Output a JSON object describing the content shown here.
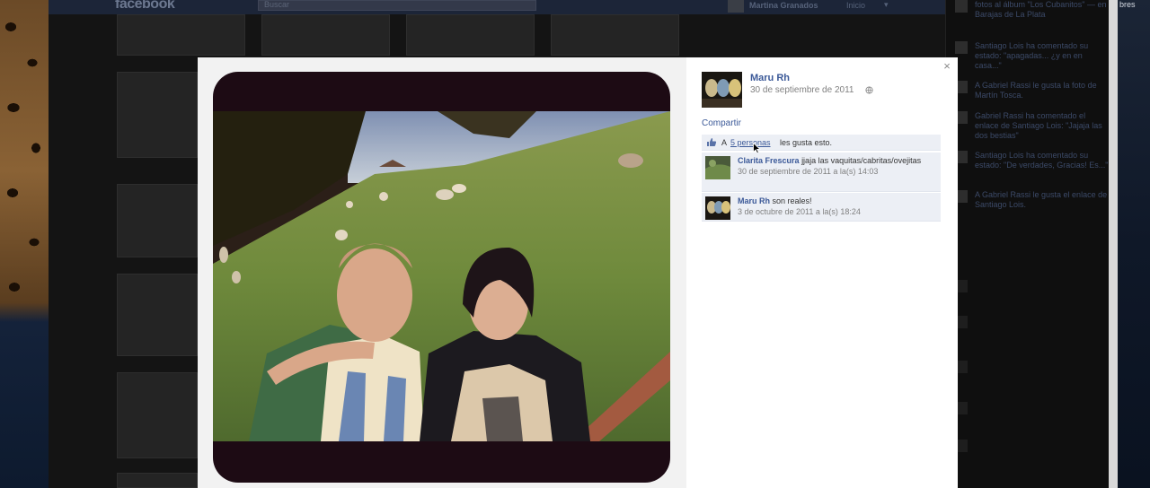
{
  "facebook": {
    "logo": "facebook",
    "search_placeholder": "Buscar",
    "user_name": "Martina Granados",
    "home_label": "Inicio"
  },
  "desktop": {
    "edge_text": "bres"
  },
  "ticker": [
    {
      "text": "fotos al álbum \"Los Cubanitos\" — en Barajas de La Plata"
    },
    {
      "text": "Santiago Lois ha comentado su estado: \"apagadas... ¿y en en casa...\""
    },
    {
      "text": "A Gabriel Rassi le gusta la foto de Martín Tosca."
    },
    {
      "text": "Gabriel Rassi ha comentado el enlace de Santiago Lois: \"Jajaja las dos bestias\""
    },
    {
      "text": "Santiago Lois ha comentado su estado: \"De verdades, Gracias! Es...\""
    },
    {
      "text": "A Gabriel Rassi le gusta el enlace de Santiago Lois."
    }
  ],
  "photo": {
    "owner_name": "Maru Rh",
    "date": "30 de septiembre de 2011",
    "share_label": "Compartir",
    "close_symbol": "×"
  },
  "likes": {
    "prefix": "A",
    "link": "5 personas",
    "suffix": "les gusta esto."
  },
  "comments": [
    {
      "author": "Clarita Frescura",
      "text": "jjaja las vaquitas/cabritas/ovejitas",
      "time": "30 de septiembre de 2011 a la(s) 14:03"
    },
    {
      "author": "Maru Rh",
      "text": "son reales!",
      "time": "3 de octubre de 2011 a la(s) 18:24"
    }
  ],
  "colors": {
    "link_blue": "#3b5998",
    "comment_bg": "#eceff5",
    "photo_frame": "#1d0b14"
  }
}
